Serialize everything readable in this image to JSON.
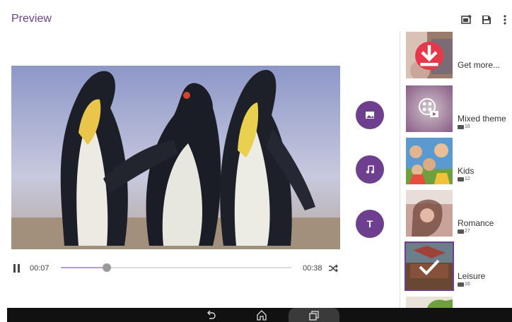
{
  "header": {
    "title": "Preview",
    "icons": [
      "add-photo-icon",
      "save-icon",
      "more-vert-icon"
    ]
  },
  "video": {
    "current_time": "00:07",
    "total_time": "00:38",
    "progress": 0.2
  },
  "side_actions": {
    "image_button_icon": "image-icon",
    "music_button_icon": "music-note-icon",
    "text_button_label": "T"
  },
  "themes": [
    {
      "label": "Get more...",
      "count": "",
      "icon": "download-icon"
    },
    {
      "label": "Mixed theme",
      "count": "16",
      "icon": "film-reel-icon"
    },
    {
      "label": "Kids",
      "count": "12",
      "icon": ""
    },
    {
      "label": "Romance",
      "count": "27",
      "icon": ""
    },
    {
      "label": "Leisure",
      "count": "16",
      "icon": "checkmark-icon",
      "selected": true
    }
  ],
  "colors": {
    "accent": "#6d3f8e",
    "download": "#e5384a"
  },
  "navbar": {
    "icons": [
      "back-icon",
      "home-icon",
      "recent-apps-icon"
    ]
  }
}
